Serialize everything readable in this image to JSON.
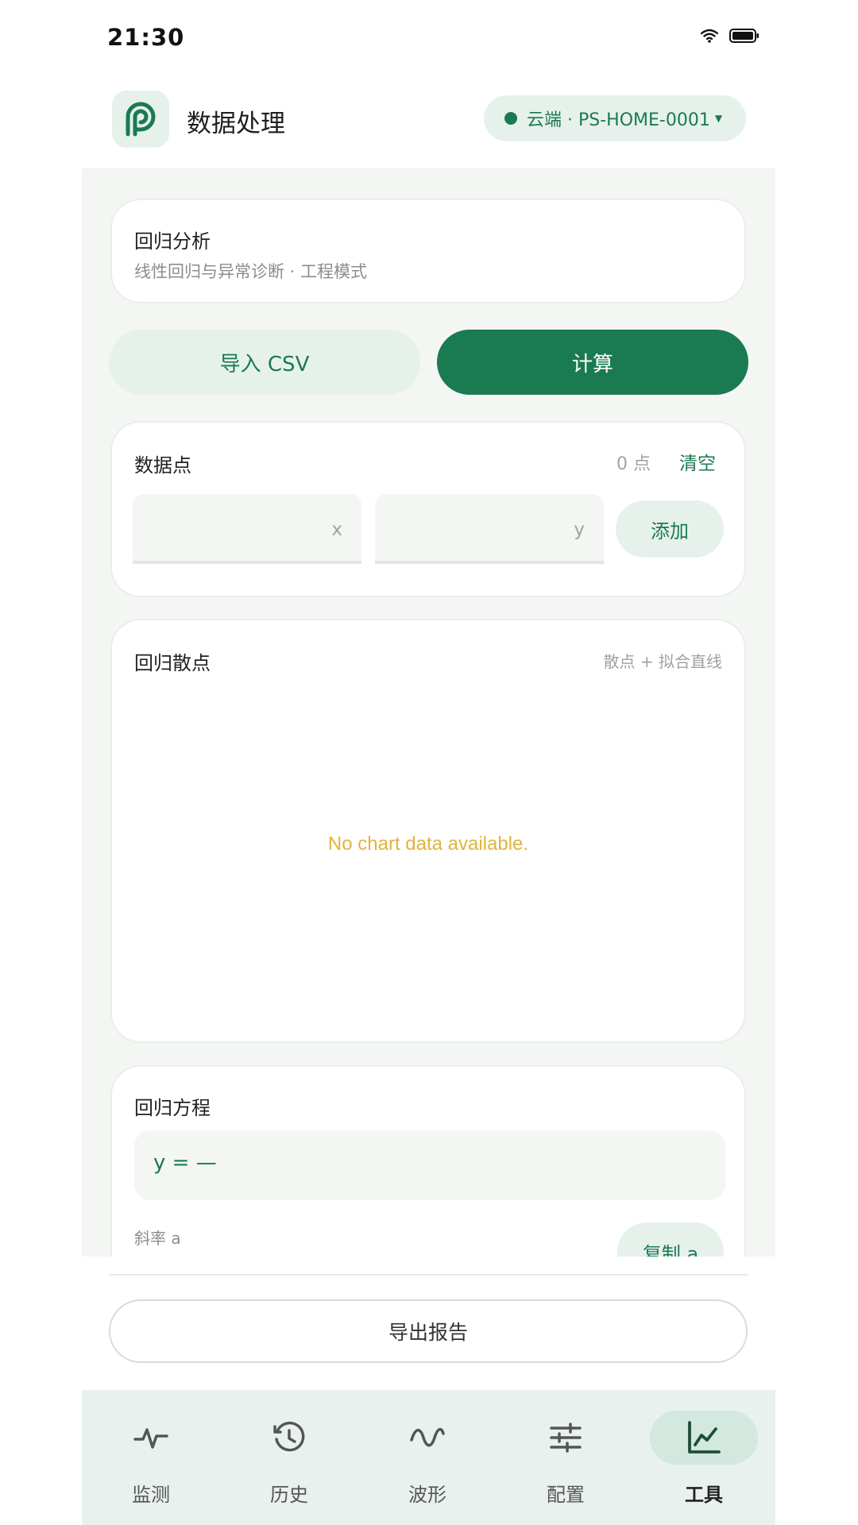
{
  "status_bar": {
    "time": "21:30"
  },
  "header": {
    "title": "数据处理",
    "device": "云端 · PS-HOME-0001",
    "accent": "#1a7a52"
  },
  "intro_card": {
    "title": "回归分析",
    "subtitle": "线性回归与异常诊断 · 工程模式"
  },
  "actions": {
    "import_label": "导入 CSV",
    "compute_label": "计算"
  },
  "data_points": {
    "title": "数据点",
    "count": "0 点",
    "clear_label": "清空",
    "x_placeholder": "x",
    "y_placeholder": "y",
    "add_label": "添加"
  },
  "scatter": {
    "title": "回归散点",
    "hint": "散点 + 拟合直线",
    "empty_message": "No chart data available."
  },
  "equation": {
    "title": "回归方程",
    "value": "y = —",
    "slope_label": "斜率 a",
    "copy_label": "复制 a"
  },
  "export": {
    "label": "导出报告"
  },
  "nav": {
    "items": [
      {
        "label": "监测",
        "icon": "pulse-icon"
      },
      {
        "label": "历史",
        "icon": "history-icon"
      },
      {
        "label": "波形",
        "icon": "wave-icon"
      },
      {
        "label": "配置",
        "icon": "sliders-icon"
      },
      {
        "label": "工具",
        "icon": "chart-icon",
        "active": true
      }
    ]
  }
}
